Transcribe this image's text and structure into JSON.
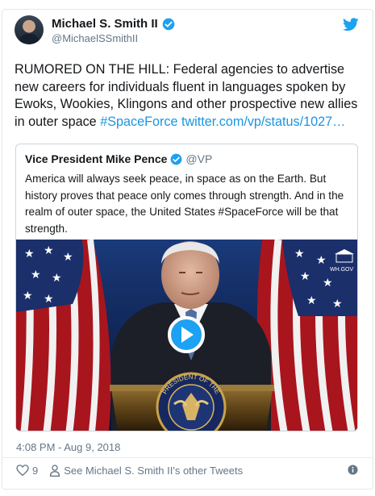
{
  "author": {
    "name": "Michael S. Smith II",
    "handle": "@MichaelSSmithII"
  },
  "tweet": {
    "text": "RUMORED ON THE HILL: Federal agencies to advertise new careers for individuals fluent in languages spoken by Ewoks, Wookies, Klingons and other prospective new allies in outer space ",
    "hashtag": "#SpaceForce",
    "link": "twitter.com/vp/status/1027…",
    "timestamp": "4:08 PM - Aug 9, 2018"
  },
  "quoted_tweet": {
    "name": "Vice President Mike Pence",
    "handle": "@VP",
    "text": "America will always seek peace, in space as on the Earth. But history proves that peace only comes through strength. And in the realm of outer space, the United States #SpaceForce will be that strength.",
    "media": {
      "watermark": "WH.GOV",
      "seal_top": "PRESIDENT OF THE",
      "seal_bottom": "UNITED STATES"
    }
  },
  "footer": {
    "likes": "9",
    "other_tweets_label": "See Michael S. Smith II's other Tweets"
  },
  "colors": {
    "brand_blue": "#1da1f2",
    "link_blue": "#1b95e0",
    "muted": "#657786"
  },
  "icons": [
    "twitter-bird-icon",
    "verified-badge-icon",
    "heart-icon",
    "person-icon",
    "info-icon",
    "play-icon"
  ]
}
